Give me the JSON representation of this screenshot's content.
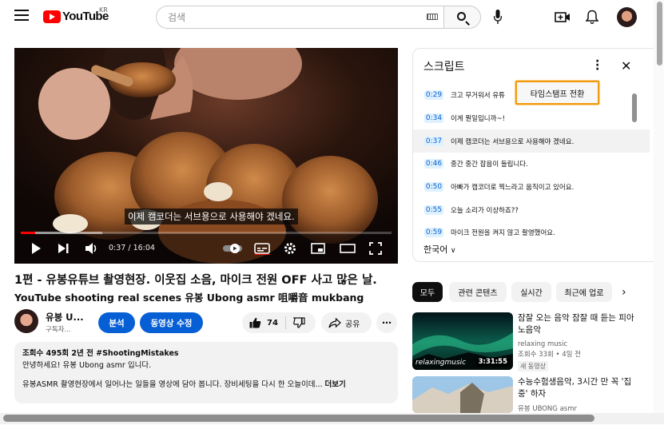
{
  "header": {
    "logo_text": "YouTube",
    "country": "KR",
    "search_placeholder": "검색"
  },
  "player": {
    "caption": "이제 캠코더는 서브용으로 사용해야 겠네요.",
    "time": "0:37 / 16:04",
    "progress_fraction": 0.038
  },
  "video": {
    "title": "1편 - 유봉유튜브 촬영현장. 이웃집 소음, 마이크 전원 OFF 사고 많은 날.",
    "subtitle": "YouTube shooting real scenes 유봉 Ubong asmr 咀嚼音 mukbang",
    "channel_name": "유봉 U...",
    "subscribers": "구독자...",
    "analytics_label": "분석",
    "edit_label": "동영상 수정",
    "likes": "74",
    "share_label": "공유",
    "description": {
      "meta": "조회수 495회  2년 전  #ShootingMistakes",
      "line1": "안녕하세요! 유봉 Ubong asmr 입니다.",
      "line2": "유봉ASMR 촬영현장에서 일어나는 일들을 영상에 담아 봅니다. 장비세팅을 다시 한 오늘이데...",
      "more": "더보기"
    }
  },
  "transcript": {
    "title": "스크립트",
    "popup_label": "타임스탬프 전환",
    "language": "한국어",
    "rows": [
      {
        "ts": "0:29",
        "text": "크고 무거워서 유튜"
      },
      {
        "ts": "0:34",
        "text": "이게 뭔일입니까~!"
      },
      {
        "ts": "0:37",
        "text": "이제 캠코더는 서브용으로 사용해야 겠네요."
      },
      {
        "ts": "0:46",
        "text": "중간 중간 잡음이 들립니다."
      },
      {
        "ts": "0:50",
        "text": "아빠가 캠코더로 찍느라고 움직이고 있어요."
      },
      {
        "ts": "0:55",
        "text": "오늘 소리가 이상하죠??"
      },
      {
        "ts": "0:59",
        "text": "마이크 전원을 켜지 않고 촬영했어요."
      }
    ]
  },
  "chips": [
    "모두",
    "관련 콘텐츠",
    "실시간",
    "최근에 업로"
  ],
  "recommendations": [
    {
      "title": "잠잘 오는 음악 잠잘 때 듣는 피아노음악",
      "channel": "relaxing music",
      "views": "조회수 33회 • 4일 전",
      "badge": "새 동영상",
      "duration": "3:31:55",
      "thumb_brand": "relaxingmusic"
    },
    {
      "title": "수능수험생음악, 3시간 만 꼭 '집중' 하자",
      "channel": "유봉 UBONG asmr",
      "duration": ""
    }
  ],
  "colors": {
    "accent": "#065fd4",
    "youtube_red": "#ff0000",
    "popup_border": "#f29a0e"
  }
}
